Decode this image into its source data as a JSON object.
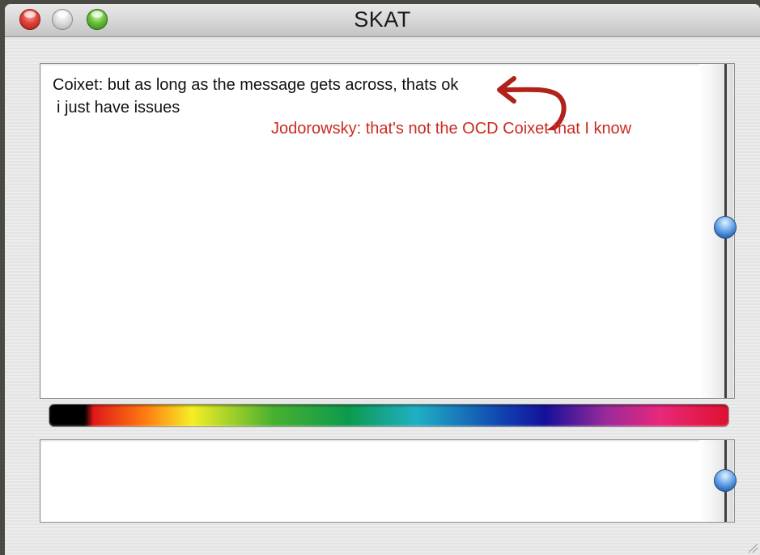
{
  "window": {
    "title": "SKAT"
  },
  "chat": {
    "messages": [
      {
        "text": "Coixet: but as long as the message gets across, thats ok"
      },
      {
        "text": "i just have issues"
      }
    ],
    "reply": {
      "text": "Jodorowsky: that's not the OCD Coixet that I know",
      "color": "#cc2a20"
    },
    "arrow_icon": "curved-arrow-icon"
  },
  "colors": {
    "reply_red": "#cc2a20",
    "scroll_knob_blue": "#1f5fb2"
  },
  "input": {
    "value": ""
  }
}
